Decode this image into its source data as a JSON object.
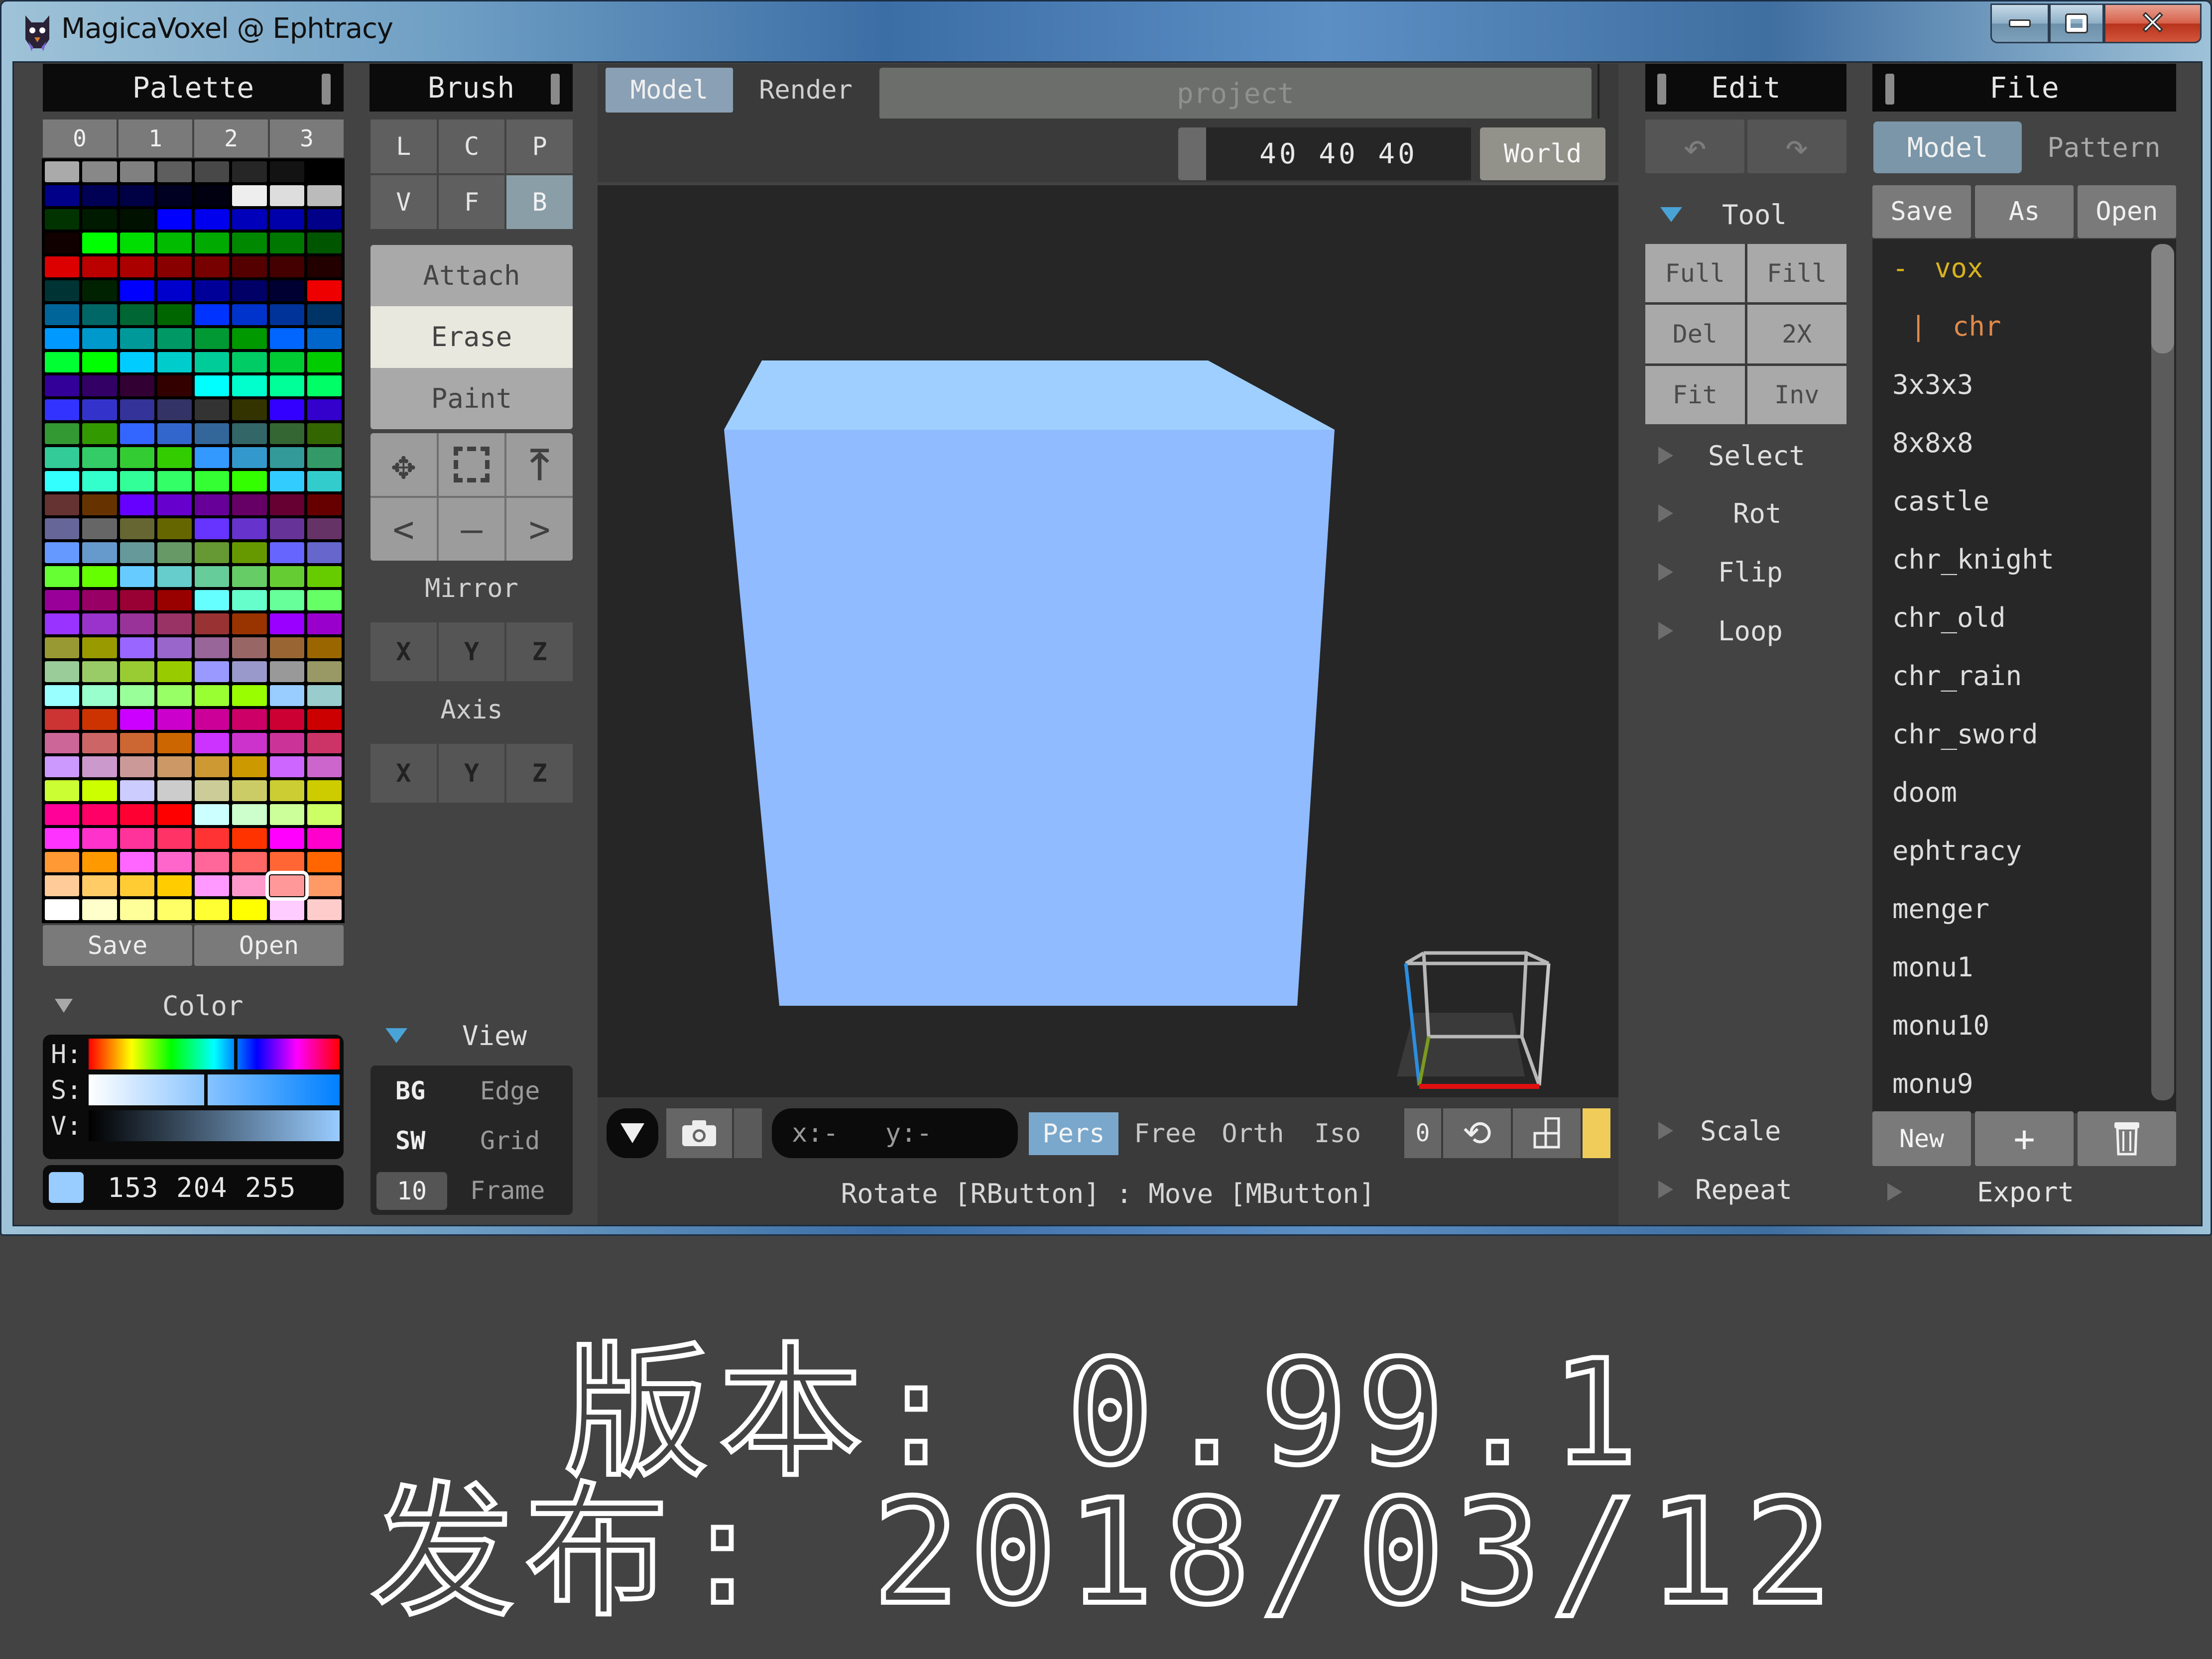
{
  "window": {
    "title": "MagicaVoxel @ Ephtracy",
    "controls": {
      "minimize": "minimize",
      "maximize": "maximize",
      "close": "close"
    }
  },
  "palette": {
    "title": "Palette",
    "tabs": [
      "0",
      "1",
      "2",
      "3"
    ],
    "selected_index": 246,
    "colors": [
      "#aaaaaa",
      "#888888",
      "#808080",
      "#5e5e5e",
      "#484848",
      "#262626",
      "#131313",
      "#000000",
      "#000088",
      "#000055",
      "#000044",
      "#000022",
      "#000011",
      "#eeeeee",
      "#dddddd",
      "#bbbbbb",
      "#003300",
      "#001a00",
      "#001100",
      "#0000ff",
      "#0000ee",
      "#0000bb",
      "#0000aa",
      "#000088",
      "#110000",
      "#00ff00",
      "#00dd00",
      "#00bb00",
      "#00aa00",
      "#008800",
      "#007700",
      "#005500",
      "#dd0000",
      "#bb0000",
      "#aa0000",
      "#880000",
      "#770000",
      "#550000",
      "#440000",
      "#220000",
      "#003333",
      "#002200",
      "#0000ff",
      "#0000cc",
      "#000099",
      "#000066",
      "#000033",
      "#ee0000",
      "#006699",
      "#006666",
      "#006633",
      "#006600",
      "#0033ff",
      "#0033cc",
      "#003399",
      "#003366",
      "#0099ff",
      "#0099cc",
      "#009999",
      "#009966",
      "#009933",
      "#009900",
      "#0066ff",
      "#0066cc",
      "#00ff33",
      "#00ff00",
      "#00ccff",
      "#00cccc",
      "#00cc99",
      "#00cc66",
      "#00cc33",
      "#00cc00",
      "#330099",
      "#330066",
      "#330033",
      "#330000",
      "#00ffff",
      "#00ffcc",
      "#00ff99",
      "#00ff66",
      "#3333ff",
      "#3333cc",
      "#333399",
      "#333366",
      "#333333",
      "#333300",
      "#3300ff",
      "#3300cc",
      "#339933",
      "#339900",
      "#3366ff",
      "#3366cc",
      "#336699",
      "#336666",
      "#336633",
      "#336600",
      "#33cc99",
      "#33cc66",
      "#33cc33",
      "#33cc00",
      "#3399ff",
      "#3399cc",
      "#339999",
      "#339966",
      "#33ffff",
      "#33ffcc",
      "#33ff99",
      "#33ff66",
      "#33ff33",
      "#33ff00",
      "#33ccff",
      "#33cccc",
      "#663333",
      "#663300",
      "#6600ff",
      "#6600cc",
      "#660099",
      "#660066",
      "#660033",
      "#660000",
      "#666699",
      "#666666",
      "#666633",
      "#666600",
      "#6633ff",
      "#6633cc",
      "#663399",
      "#663366",
      "#6699ff",
      "#6699cc",
      "#669999",
      "#669966",
      "#669933",
      "#669900",
      "#6666ff",
      "#6666cc",
      "#66ff33",
      "#66ff00",
      "#66ccff",
      "#66cccc",
      "#66cc99",
      "#66cc66",
      "#66cc33",
      "#66cc00",
      "#990099",
      "#990066",
      "#990033",
      "#990000",
      "#66ffff",
      "#66ffcc",
      "#66ff99",
      "#66ff66",
      "#9933ff",
      "#9933cc",
      "#993399",
      "#993366",
      "#993333",
      "#993300",
      "#9900ff",
      "#9900cc",
      "#999933",
      "#999900",
      "#9966ff",
      "#9966cc",
      "#996699",
      "#996666",
      "#996633",
      "#996600",
      "#99cc99",
      "#99cc66",
      "#99cc33",
      "#99cc00",
      "#9999ff",
      "#9999cc",
      "#999999",
      "#999966",
      "#99ffff",
      "#99ffcc",
      "#99ff99",
      "#99ff66",
      "#99ff33",
      "#99ff00",
      "#99ccff",
      "#99cccc",
      "#cc3333",
      "#cc3300",
      "#cc00ff",
      "#cc00cc",
      "#cc0099",
      "#cc0066",
      "#cc0033",
      "#cc0000",
      "#cc6699",
      "#cc6666",
      "#cc6633",
      "#cc6600",
      "#cc33ff",
      "#cc33cc",
      "#cc3399",
      "#cc3366",
      "#cc99ff",
      "#cc99cc",
      "#cc9999",
      "#cc9966",
      "#cc9933",
      "#cc9900",
      "#cc66ff",
      "#cc66cc",
      "#ccff33",
      "#ccff00",
      "#ccccff",
      "#cccccc",
      "#cccc99",
      "#cccc66",
      "#cccc33",
      "#cccc00",
      "#ff0099",
      "#ff0066",
      "#ff0033",
      "#ff0000",
      "#ccffff",
      "#ccffcc",
      "#ccff99",
      "#ccff66",
      "#ff33ff",
      "#ff33cc",
      "#ff3399",
      "#ff3366",
      "#ff3333",
      "#ff3300",
      "#ff00ff",
      "#ff00cc",
      "#ff9933",
      "#ff9900",
      "#ff66ff",
      "#ff66cc",
      "#ff6699",
      "#ff6666",
      "#ff6633",
      "#ff6600",
      "#ffcc99",
      "#ffcc66",
      "#ffcc33",
      "#ffcc00",
      "#ff99ff",
      "#ff99cc",
      "#ff9999",
      "#ff9966",
      "#ffffff",
      "#ffffcc",
      "#ffff99",
      "#ffff66",
      "#ffff33",
      "#ffff00",
      "#ffccff",
      "#ffcccc"
    ],
    "save_label": "Save",
    "open_label": "Open"
  },
  "color": {
    "title": "Color",
    "h_label": "H:",
    "s_label": "S:",
    "v_label": "V:",
    "hue_fraction": 0.58,
    "sat_fraction": 0.4,
    "val_fraction": 1.0,
    "rgb_text": "153 204 255",
    "current_hex": "#99ccff"
  },
  "brush": {
    "title": "Brush",
    "modes": [
      "L",
      "C",
      "P",
      "V",
      "F",
      "B"
    ],
    "active_mode": "B",
    "actions": [
      "Attach",
      "Erase",
      "Paint"
    ],
    "active_action": "Erase",
    "tools": [
      {
        "icon": "move-icon",
        "glyph": "✥"
      },
      {
        "icon": "select-region-icon",
        "glyph": "⛶"
      },
      {
        "icon": "extrude-up-icon",
        "glyph": "⤒"
      },
      {
        "icon": "chevron-left-icon",
        "glyph": "<"
      },
      {
        "icon": "dash-icon",
        "glyph": "—"
      },
      {
        "icon": "chevron-right-icon",
        "glyph": ">"
      }
    ],
    "mirror_label": "Mirror",
    "mirror_axes": [
      "X",
      "Y",
      "Z"
    ],
    "axis_label": "Axis",
    "axis_axes": [
      "X",
      "Y",
      "Z"
    ]
  },
  "view": {
    "title": "View",
    "rows": [
      {
        "left": "BG",
        "right": "Edge"
      },
      {
        "left": "SW",
        "right": "Grid"
      },
      {
        "left": "10",
        "right": "Frame"
      }
    ]
  },
  "center": {
    "tabs": [
      "Model",
      "Render"
    ],
    "active_tab": "Model",
    "project_placeholder": "project",
    "size": "40 40 40",
    "world_label": "World",
    "toolbar": {
      "coords": "x:-   y:-",
      "projections": [
        "Pers",
        "Free",
        "Orth",
        "Iso"
      ],
      "active_projection": "Pers",
      "zero_label": "0"
    },
    "status": "Rotate [RButton] : Move [MButton]",
    "model_color": "#99ccff"
  },
  "edit": {
    "title": "Edit",
    "tool_title": "Tool",
    "tool_buttons": [
      "Full",
      "Fill",
      "Del",
      "2X",
      "Fit",
      "Inv"
    ],
    "folds": [
      "Select",
      "Rot",
      "Flip",
      "Loop"
    ],
    "bottom_folds": [
      "Scale",
      "Repeat"
    ]
  },
  "file": {
    "title": "File",
    "tabs": [
      "Model",
      "Pattern"
    ],
    "active_tab": "Model",
    "actions": [
      "Save",
      "As",
      "Open"
    ],
    "tree": [
      {
        "prefix": "- ",
        "name": "vox",
        "color": "#d8b21e",
        "indent": 0
      },
      {
        "prefix": "| ",
        "name": "chr",
        "color": "#e08a4a",
        "indent": 1
      }
    ],
    "items": [
      "3x3x3",
      "8x8x8",
      "castle",
      "chr_knight",
      "chr_old",
      "chr_rain",
      "chr_sword",
      "doom",
      "ephtracy",
      "menger",
      "monu1",
      "monu10",
      "monu9"
    ],
    "new_label": "New",
    "add_label": "+",
    "export_label": "Export"
  },
  "caption": {
    "version_line": "版本: 0.99.1",
    "release_line": "发布: 2018/03/12"
  }
}
